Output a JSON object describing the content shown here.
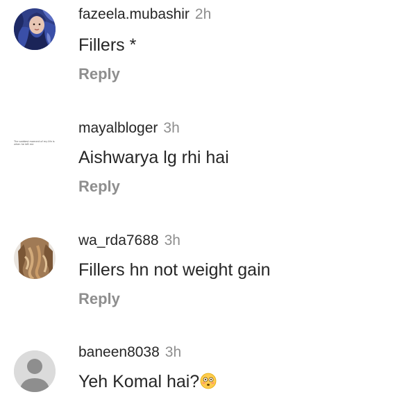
{
  "comments": [
    {
      "username": "fazeela.mubashir",
      "time": "2h",
      "text": "Fillers *",
      "reply_label": "Reply",
      "avatar": "hijab-portrait-avatar"
    },
    {
      "username": "mayalbloger",
      "time": "3h",
      "text": "Aishwarya lg rhi hai",
      "reply_label": "Reply",
      "avatar": "tiny-text-avatar",
      "avatar_text": "The saddest moment of my life is when he left me"
    },
    {
      "username": "wa_rda7688",
      "time": "3h",
      "text": "Fillers hn not weight gain",
      "reply_label": "Reply",
      "avatar": "wavy-hair-avatar"
    },
    {
      "username": "baneen8038",
      "time": "3h",
      "text": "Yeh Komal hai?",
      "emoji": "flushed-face-emoji",
      "avatar": "default-profile-avatar"
    }
  ],
  "colors": {
    "username": "#262626",
    "secondary": "#8e8e8e",
    "default_avatar_bg": "#dbdbdb",
    "default_avatar_fg": "#ffffff"
  }
}
